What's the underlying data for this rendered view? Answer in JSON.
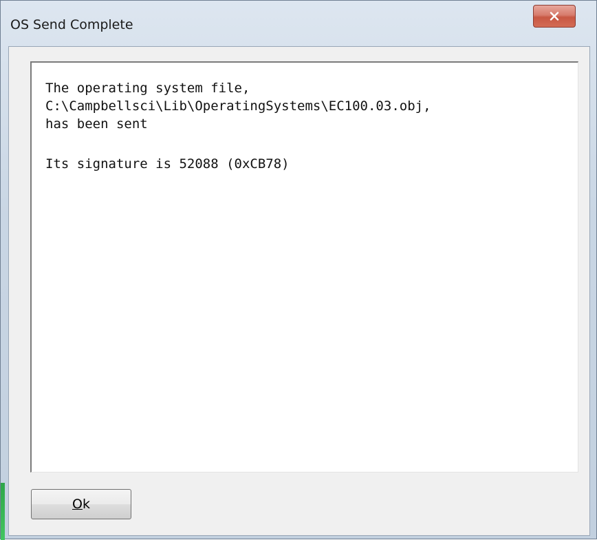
{
  "window": {
    "title": "OS Send Complete",
    "close_icon": "close-x-icon"
  },
  "message": {
    "lines": [
      "The operating system file,",
      "C:\\Campbellsci\\Lib\\OperatingSystems\\EC100.03.obj,",
      "has been sent"
    ],
    "signature_line": "Its signature is 52088 (0xCB78)"
  },
  "buttons": {
    "ok": {
      "mnemonic": "O",
      "rest": "k"
    }
  },
  "colors": {
    "close_button": "#d36c55",
    "title_bar": "#c9d6e4"
  }
}
